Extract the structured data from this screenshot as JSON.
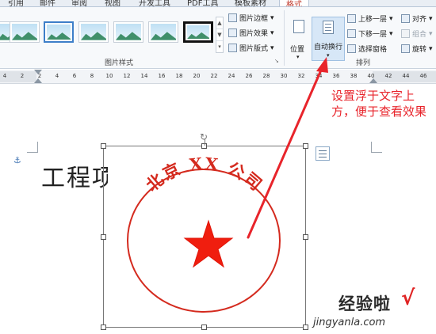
{
  "tabs": [
    {
      "label": "引用"
    },
    {
      "label": "邮件"
    },
    {
      "label": "审阅"
    },
    {
      "label": "视图"
    },
    {
      "label": "开发工具"
    },
    {
      "label": "PDF工具"
    },
    {
      "label": "模板素材"
    },
    {
      "label": "格式",
      "active": true
    }
  ],
  "ribbon": {
    "picture_styles": {
      "label": "图片样式",
      "commands": [
        "图片边框",
        "图片效果",
        "图片版式"
      ]
    },
    "arrange": {
      "label": "排列",
      "position_label": "位置",
      "wrap_text_label": "自动换行",
      "commands": [
        "上移一层",
        "下移一层",
        "选择窗格"
      ],
      "right_commands": [
        "对齐",
        "组合",
        "旋转"
      ]
    }
  },
  "ruler": {
    "ticks": [
      "4",
      "2",
      "2",
      "4",
      "6",
      "8",
      "10",
      "12",
      "14",
      "16",
      "18",
      "20",
      "22",
      "24",
      "26",
      "28",
      "30",
      "32",
      "34",
      "36",
      "38",
      "40",
      "42",
      "44",
      "46"
    ]
  },
  "document": {
    "heading_text": "工程项目",
    "seal": {
      "arc_text": "北京 XX 公司",
      "color": "#d42a1e"
    }
  },
  "annotation": {
    "text": "设置浮于文字上方，便于查看效果",
    "color": "#e8242b"
  },
  "watermark": {
    "title": "经验啦",
    "check": "√",
    "url": "jingyanla.com"
  }
}
